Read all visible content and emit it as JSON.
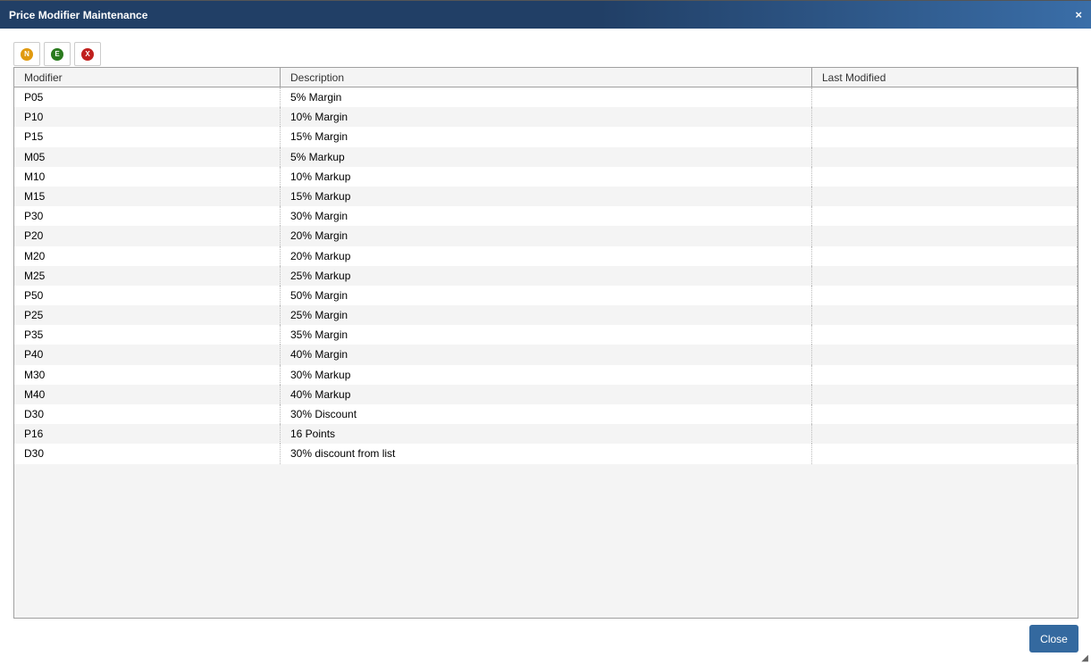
{
  "window": {
    "title": "Price Modifier Maintenance",
    "close_glyph": "×"
  },
  "toolbar": [
    {
      "letter": "N",
      "name": "new",
      "color": "#e09a10"
    },
    {
      "letter": "E",
      "name": "edit",
      "color": "#2a7a1e"
    },
    {
      "letter": "X",
      "name": "delete",
      "color": "#c0201e"
    }
  ],
  "columns": [
    "Modifier",
    "Description",
    "Last Modified"
  ],
  "rows": [
    [
      "P05",
      "5% Margin",
      ""
    ],
    [
      "P10",
      "10% Margin",
      ""
    ],
    [
      "P15",
      "15% Margin",
      ""
    ],
    [
      "M05",
      "5% Markup",
      ""
    ],
    [
      "M10",
      "10% Markup",
      ""
    ],
    [
      "M15",
      "15% Markup",
      ""
    ],
    [
      "P30",
      "30% Margin",
      ""
    ],
    [
      "P20",
      "20% Margin",
      ""
    ],
    [
      "M20",
      "20% Markup",
      ""
    ],
    [
      "M25",
      "25% Markup",
      ""
    ],
    [
      "P50",
      "50% Margin",
      ""
    ],
    [
      "P25",
      "25% Margin",
      ""
    ],
    [
      "P35",
      "35% Margin",
      ""
    ],
    [
      "P40",
      "40% Margin",
      ""
    ],
    [
      "M30",
      "30% Markup",
      ""
    ],
    [
      "M40",
      "40% Markup",
      ""
    ],
    [
      "D30",
      "30% Discount",
      ""
    ],
    [
      "P16",
      "16 Points",
      ""
    ],
    [
      "D30",
      "30% discount from list",
      ""
    ]
  ],
  "footer": {
    "close_label": "Close"
  }
}
